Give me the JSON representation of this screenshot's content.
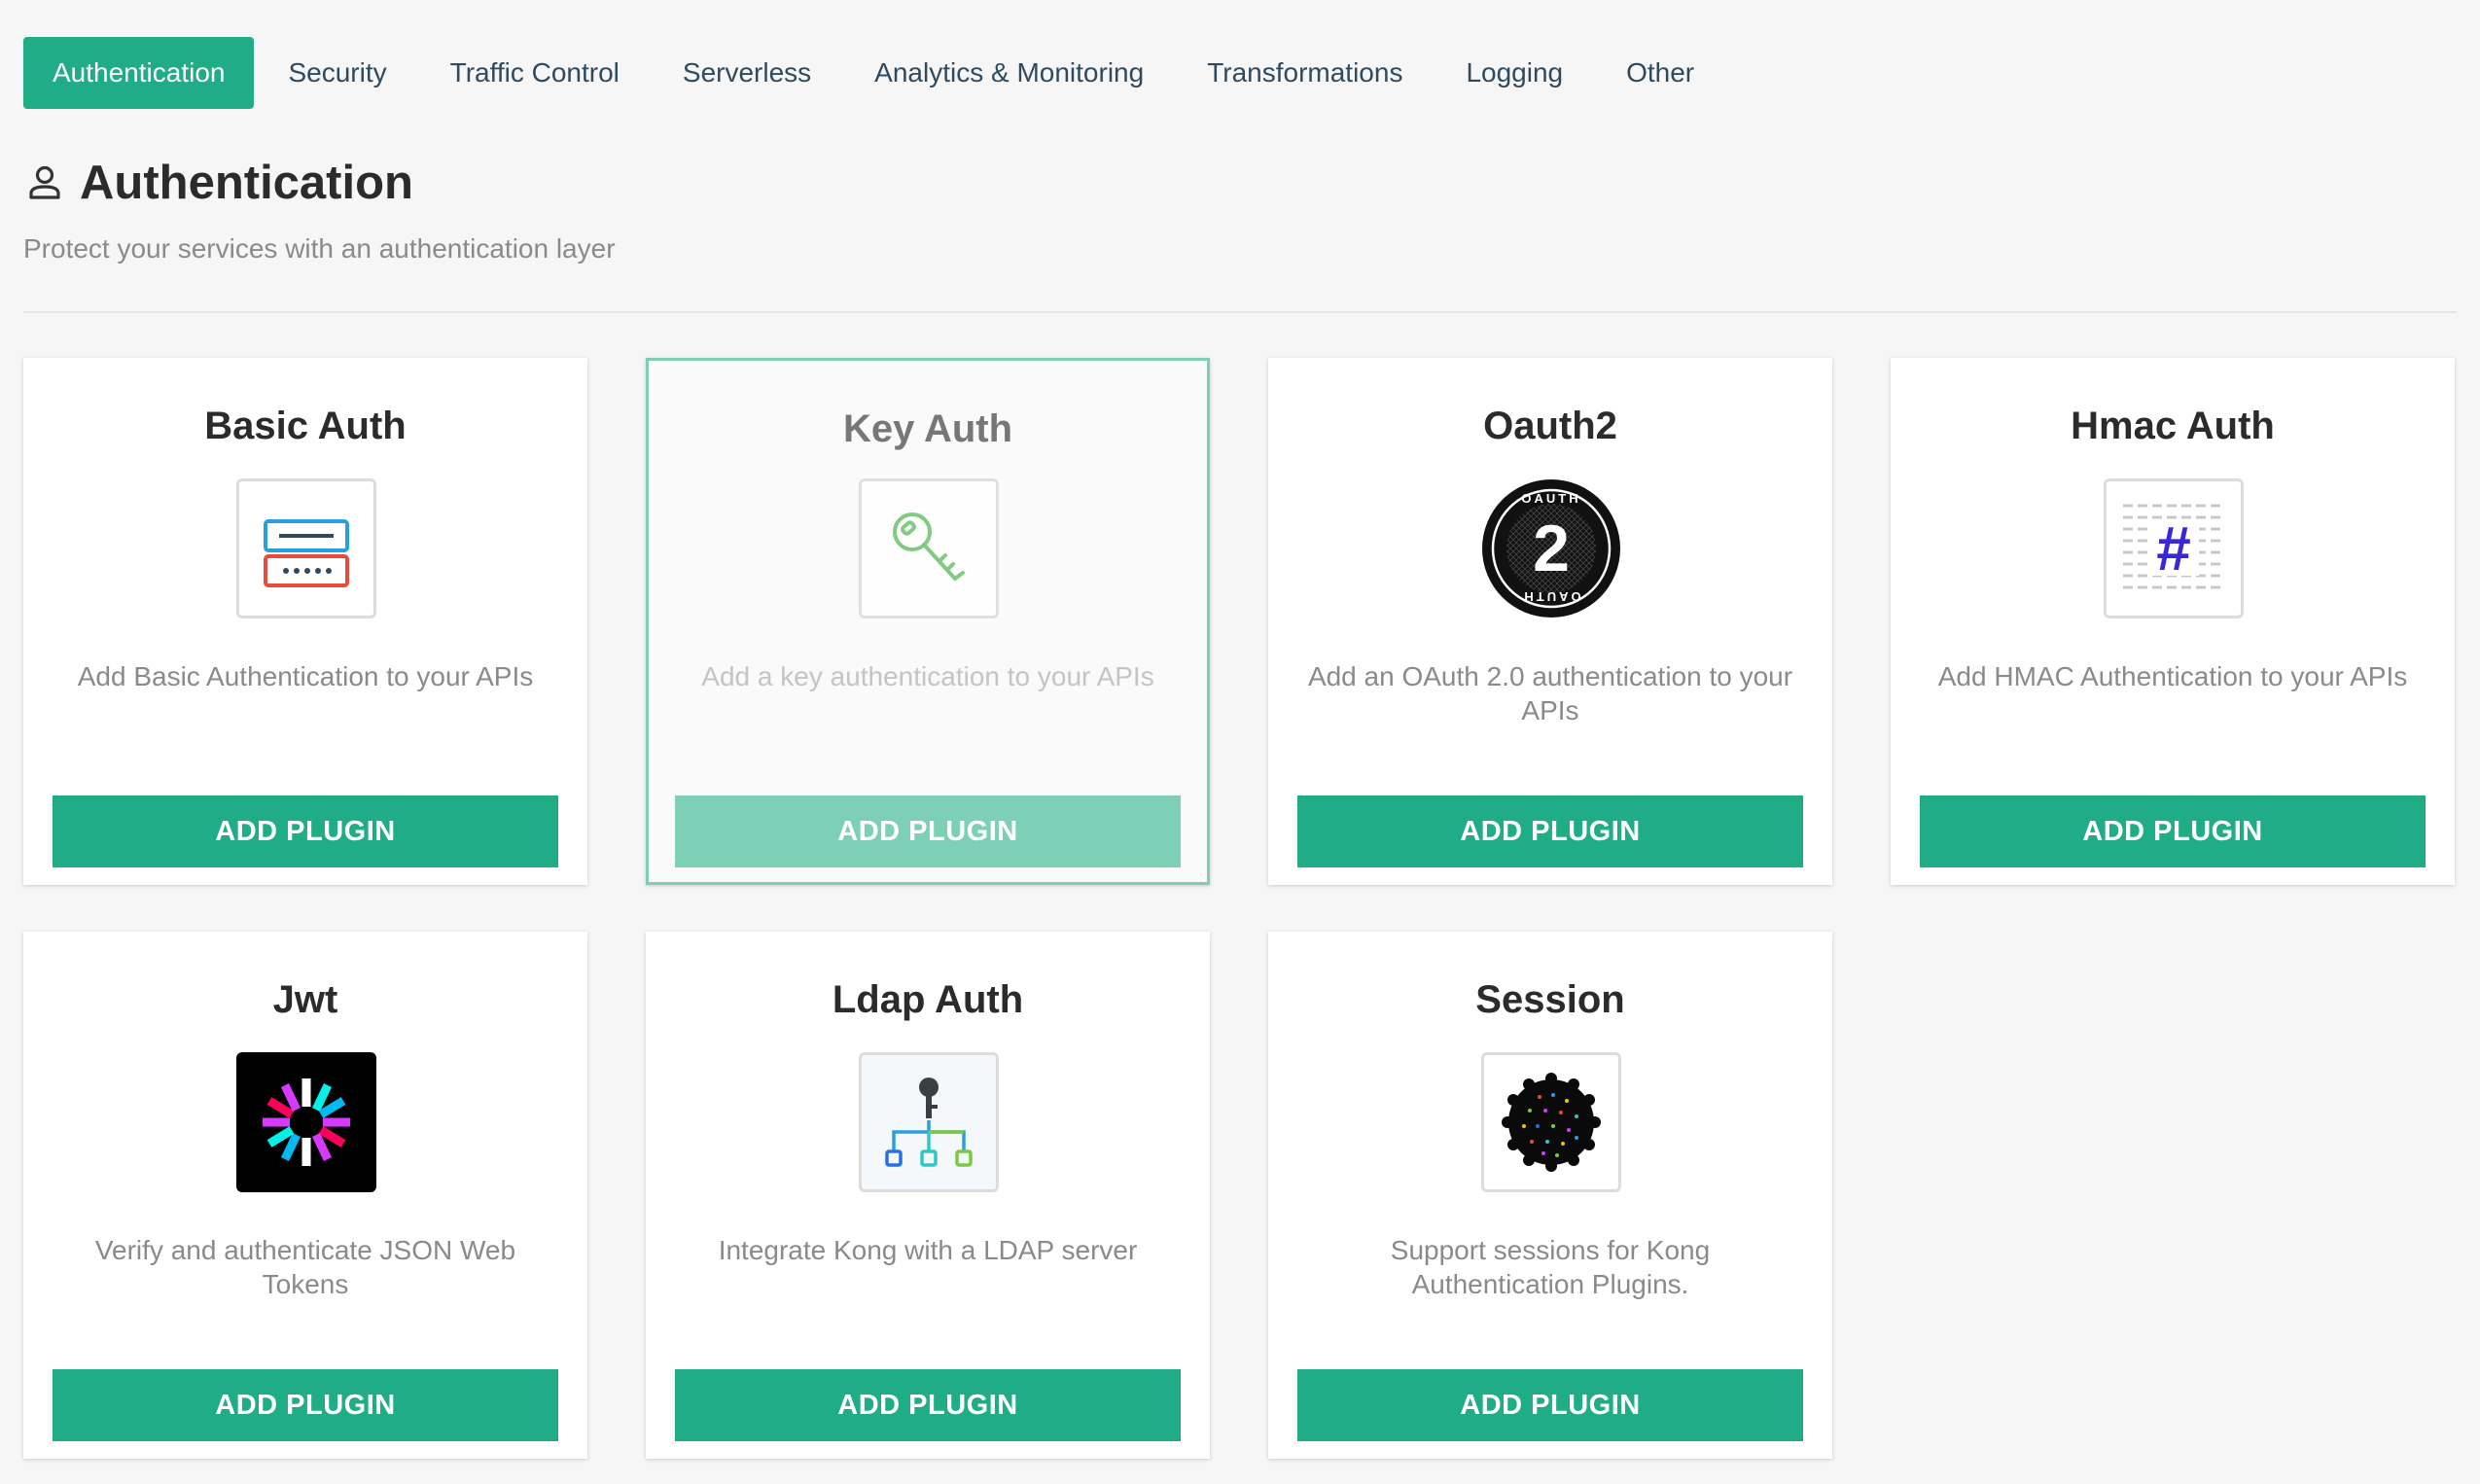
{
  "tabs": [
    {
      "label": "Authentication",
      "active": true
    },
    {
      "label": "Security"
    },
    {
      "label": "Traffic Control"
    },
    {
      "label": "Serverless"
    },
    {
      "label": "Analytics & Monitoring"
    },
    {
      "label": "Transformations"
    },
    {
      "label": "Logging"
    },
    {
      "label": "Other"
    }
  ],
  "header": {
    "title": "Authentication",
    "subtitle": "Protect your services with an authentication layer",
    "icon": "user-icon"
  },
  "colors": {
    "accent": "#20ac86",
    "accent_light": "#7dd0b6",
    "background": "#f6f6f6"
  },
  "plugins": [
    {
      "title": "Basic Auth",
      "description": "Add Basic Authentication to your APIs",
      "button": "ADD PLUGIN",
      "icon": "basic-auth-icon"
    },
    {
      "title": "Key Auth",
      "description": "Add a key authentication to your APIs",
      "button": "ADD PLUGIN",
      "icon": "key-icon",
      "selected": true
    },
    {
      "title": "Oauth2",
      "description": "Add an OAuth 2.0 authentication to your APIs",
      "button": "ADD PLUGIN",
      "icon": "oauth2-icon",
      "logo_text": "OAUTH",
      "logo_number": "2"
    },
    {
      "title": "Hmac Auth",
      "description": "Add HMAC Authentication to your APIs",
      "button": "ADD PLUGIN",
      "icon": "hash-icon",
      "glyph": "#"
    },
    {
      "title": "Jwt",
      "description": "Verify and authenticate JSON Web Tokens",
      "button": "ADD PLUGIN",
      "icon": "jwt-icon"
    },
    {
      "title": "Ldap Auth",
      "description": "Integrate Kong with a LDAP server",
      "button": "ADD PLUGIN",
      "icon": "ldap-icon"
    },
    {
      "title": "Session",
      "description": "Support sessions for Kong Authentication Plugins.",
      "button": "ADD PLUGIN",
      "icon": "cookie-icon"
    }
  ]
}
